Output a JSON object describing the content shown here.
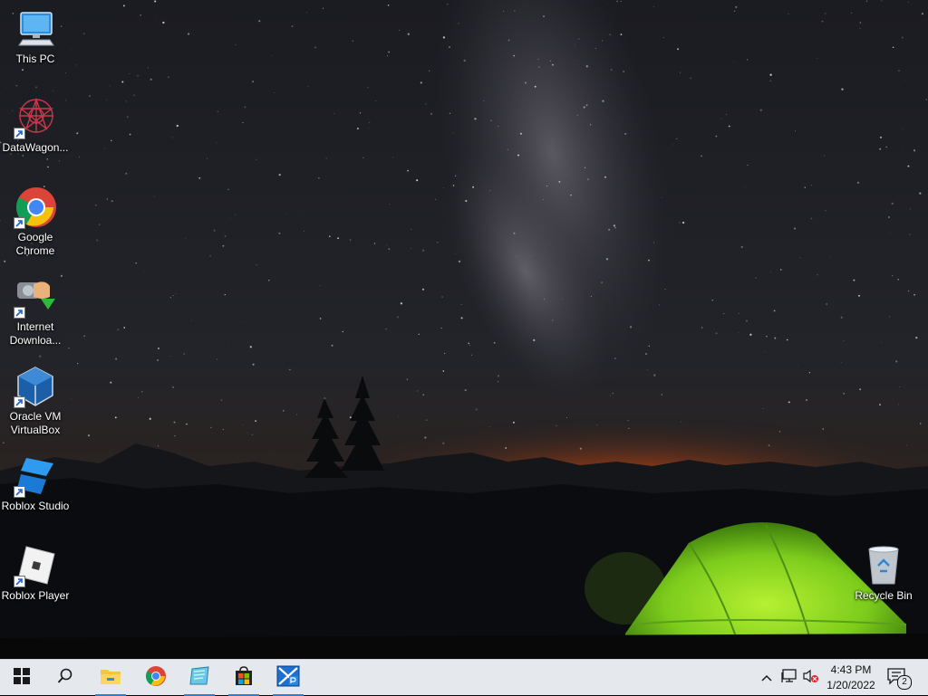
{
  "desktop": {
    "icons": [
      {
        "label": "This PC",
        "icon": "computer-icon",
        "shortcut": false
      },
      {
        "label": "DataWagon...",
        "icon": "datawagon-icon",
        "shortcut": true
      },
      {
        "label": "Google\nChrome",
        "icon": "chrome-icon",
        "shortcut": true
      },
      {
        "label": "Internet\nDownloa...",
        "icon": "internet-download-manager-icon",
        "shortcut": true
      },
      {
        "label": "Oracle VM\nVirtualBox",
        "icon": "virtualbox-icon",
        "shortcut": true
      },
      {
        "label": "Roblox Studio",
        "icon": "roblox-studio-icon",
        "shortcut": true
      },
      {
        "label": "Roblox Player",
        "icon": "roblox-player-icon",
        "shortcut": true
      },
      {
        "label": "Recycle Bin",
        "icon": "recycle-bin-icon",
        "shortcut": false
      }
    ]
  },
  "taskbar": {
    "start_icon": "windows-start-icon",
    "search_icon": "search-icon",
    "pinned": [
      {
        "name": "File Explorer",
        "icon": "file-explorer-icon",
        "running": true
      },
      {
        "name": "Google Chrome",
        "icon": "chrome-icon",
        "running": false
      },
      {
        "name": "Notepad-like app",
        "icon": "notepad-icon",
        "running": true
      },
      {
        "name": "Microsoft Store",
        "icon": "store-icon",
        "running": true
      },
      {
        "name": "XP app",
        "icon": "xp-app-icon",
        "running": true
      }
    ],
    "tray": {
      "chevron_icon": "chevron-up-icon",
      "network_icon": "network-icon",
      "volume_icon": "volume-muted-icon",
      "time": "4:43 PM",
      "date": "1/20/2022",
      "notification_icon": "action-center-icon",
      "notification_count": "2"
    }
  },
  "colors": {
    "taskbar_bg": "#e5e8ec",
    "running_indicator": "#2a7fd4",
    "tent_green": "#7ccc1c",
    "horizon_orange": "#e8641e"
  }
}
